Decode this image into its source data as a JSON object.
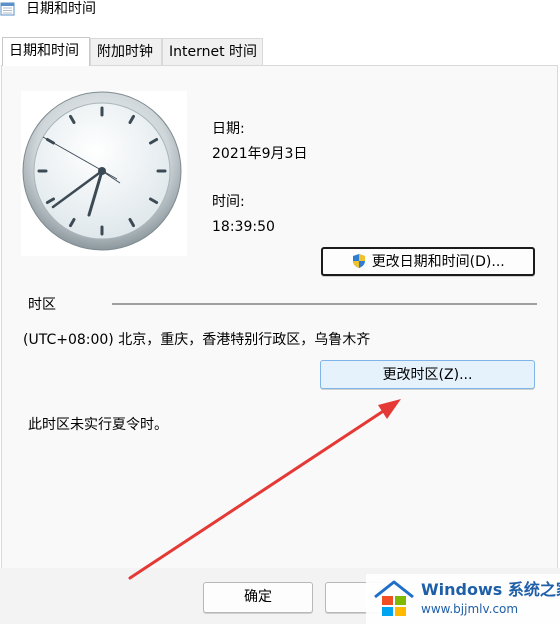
{
  "window": {
    "title": "日期和时间"
  },
  "tabs": [
    {
      "label": "日期和时间",
      "active": true
    },
    {
      "label": "附加时钟",
      "active": false
    },
    {
      "label": "Internet 时间",
      "active": false
    }
  ],
  "date_section": {
    "date_label": "日期:",
    "date_value": "2021年9月3日",
    "time_label": "时间:",
    "time_value": "18:39:50",
    "change_datetime_button": "更改日期和时间(D)..."
  },
  "timezone_section": {
    "header": "时区",
    "value": "(UTC+08:00) 北京，重庆，香港特别行政区，乌鲁木齐",
    "change_timezone_button": "更改时区(Z)...",
    "dst_note": "此时区未实行夏令时。"
  },
  "footer": {
    "ok_button": "确定"
  },
  "watermark": {
    "brand": "Windows 系统之家",
    "url": "www.bjjmlv.com"
  },
  "colors": {
    "panel_bg": "#f9f9f9",
    "highlight_button": "#e5f1fb",
    "annotation_arrow": "#e53935"
  }
}
